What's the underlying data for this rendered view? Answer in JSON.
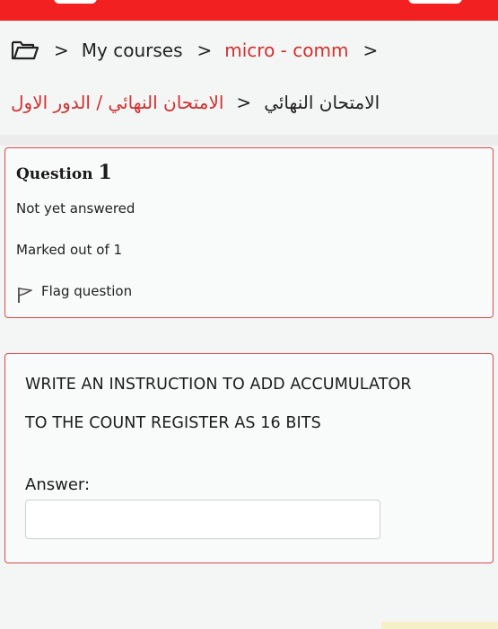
{
  "breadcrumb": {
    "home_icon": "folder-icon",
    "sep": ">",
    "my_courses": "My courses",
    "course": "micro - comm",
    "exam_section": "الامتحان النهائي",
    "exam_quiz": "الامتحان النهائي / الدور الاول"
  },
  "question_info": {
    "title_word": "Question",
    "number": "1",
    "status": "Not yet answered",
    "marks": "Marked out of 1",
    "flag_label": "Flag question",
    "flag_icon": "flag-icon"
  },
  "question": {
    "line1": "WRITE AN INSTRUCTION TO ADD ACCUMULATOR",
    "line2": "TO THE COUNT REGISTER AS 16 BITS",
    "answer_label": "Answer:",
    "answer_value": ""
  },
  "colors": {
    "status_bar": "#f22020",
    "accent": "#d32f2f",
    "card_border": "#e0474c"
  }
}
